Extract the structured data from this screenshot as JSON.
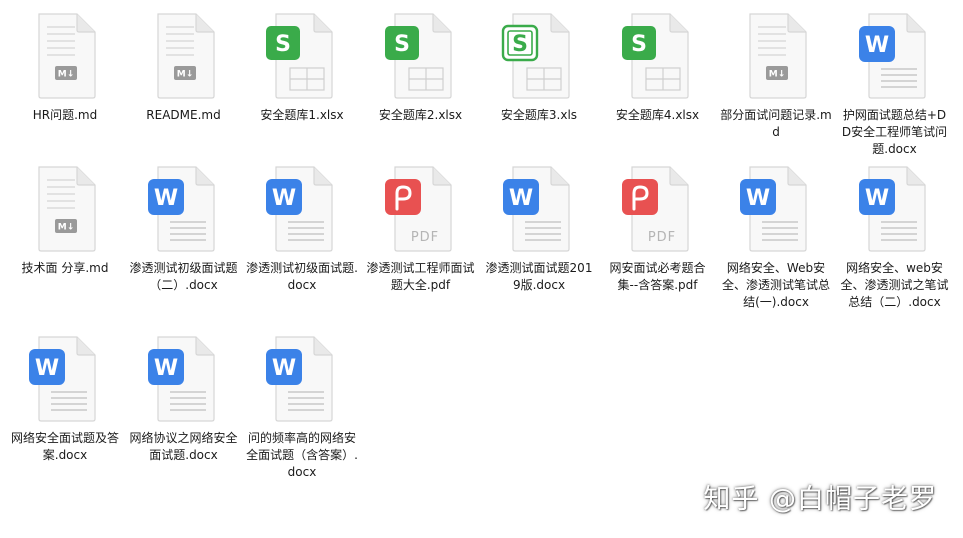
{
  "files": [
    {
      "name": "HR问题.md",
      "type": "md"
    },
    {
      "name": "README.md",
      "type": "md"
    },
    {
      "name": "安全题库1.xlsx",
      "type": "xlsx"
    },
    {
      "name": "安全题库2.xlsx",
      "type": "xlsx"
    },
    {
      "name": "安全题库3.xls",
      "type": "xls"
    },
    {
      "name": "安全题库4.xlsx",
      "type": "xlsx"
    },
    {
      "name": "部分面试问题记录.md",
      "type": "md"
    },
    {
      "name": "护网面试题总结+DD安全工程师笔试问题.docx",
      "type": "docx"
    },
    {
      "name": "技术面 分享.md",
      "type": "md"
    },
    {
      "name": "渗透测试初级面试题（二）.docx",
      "type": "docx"
    },
    {
      "name": "渗透测试初级面试题.docx",
      "type": "docx"
    },
    {
      "name": "渗透测试工程师面试题大全.pdf",
      "type": "pdf"
    },
    {
      "name": "渗透测试面试题2019版.docx",
      "type": "docx"
    },
    {
      "name": "网安面试必考题合集--含答案.pdf",
      "type": "pdf"
    },
    {
      "name": "网络安全、Web安全、渗透测试笔试总结(一).docx",
      "type": "docx"
    },
    {
      "name": "网络安全、web安全、渗透测试之笔试总结（二）.docx",
      "type": "docx"
    },
    {
      "name": "网络安全面试题及答案.docx",
      "type": "docx"
    },
    {
      "name": "网络协议之网络安全面试题.docx",
      "type": "docx"
    },
    {
      "name": "问的频率高的网络安全面试题（含答案）.docx",
      "type": "docx"
    }
  ],
  "icons": {
    "md": {
      "semantic": "markdown-file-icon",
      "badge": "M↓",
      "color": "#9a9a9a"
    },
    "xlsx": {
      "semantic": "spreadsheet-file-icon",
      "badge": "S",
      "color": "#3aab4a"
    },
    "xls": {
      "semantic": "spreadsheet-outline-file-icon",
      "badge": "S",
      "color": "#3aab4a"
    },
    "docx": {
      "semantic": "word-document-file-icon",
      "badge": "W",
      "color": "#3b82e8"
    },
    "pdf": {
      "semantic": "pdf-file-icon",
      "badge": "PDF",
      "color": "#e85151"
    }
  },
  "watermark": {
    "text": "知乎 @白帽子老罗"
  }
}
